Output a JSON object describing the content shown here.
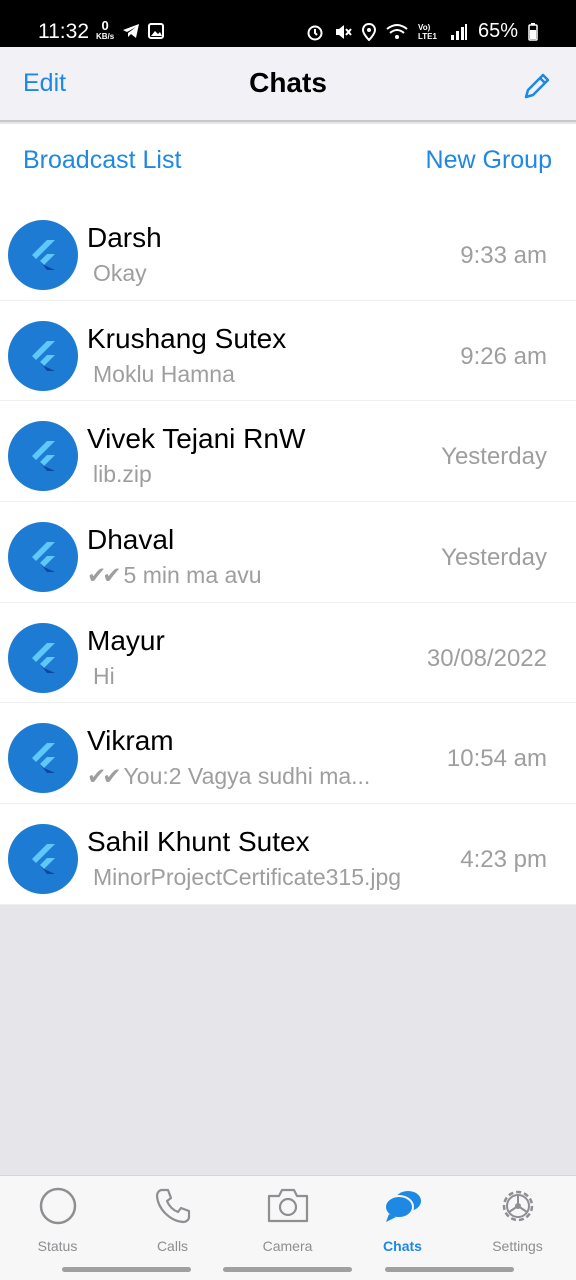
{
  "status_bar": {
    "time": "11:32",
    "net_speed_value": "0",
    "net_speed_unit": "KB/s",
    "network_label": "Vo) LTE1",
    "battery": "65%"
  },
  "header": {
    "edit_label": "Edit",
    "title": "Chats",
    "compose_icon": "pencil-icon"
  },
  "actions": {
    "broadcast_label": "Broadcast List",
    "new_group_label": "New Group"
  },
  "chats": [
    {
      "name": "Darsh",
      "preview": "Okay",
      "ticks": "",
      "time": "9:33 am"
    },
    {
      "name": "Krushang Sutex",
      "preview": "Moklu Hamna",
      "ticks": "",
      "time": "9:26 am"
    },
    {
      "name": "Vivek Tejani RnW",
      "preview": "lib.zip",
      "ticks": "",
      "time": "Yesterday"
    },
    {
      "name": "Dhaval",
      "preview": "5 min ma avu",
      "ticks": "✔✔",
      "time": "Yesterday"
    },
    {
      "name": "Mayur",
      "preview": "Hi",
      "ticks": "",
      "time": "30/08/2022"
    },
    {
      "name": "Vikram",
      "preview": "You:2 Vagya sudhi ma...",
      "ticks": "✔✔",
      "time": "10:54 am"
    },
    {
      "name": "Sahil Khunt Sutex",
      "preview": "MinorProjectCertificate315.jpg",
      "ticks": "",
      "time": "4:23 pm"
    }
  ],
  "tabs": [
    {
      "label": "Status",
      "icon": "status-circle-icon",
      "active": false
    },
    {
      "label": "Calls",
      "icon": "phone-icon",
      "active": false
    },
    {
      "label": "Camera",
      "icon": "camera-icon",
      "active": false
    },
    {
      "label": "Chats",
      "icon": "chat-bubbles-icon",
      "active": true
    },
    {
      "label": "Settings",
      "icon": "gear-icon",
      "active": false
    }
  ],
  "colors": {
    "accent": "#1e88e5",
    "avatar": "#1e7bd4",
    "secondary_text": "#9e9e9e"
  }
}
